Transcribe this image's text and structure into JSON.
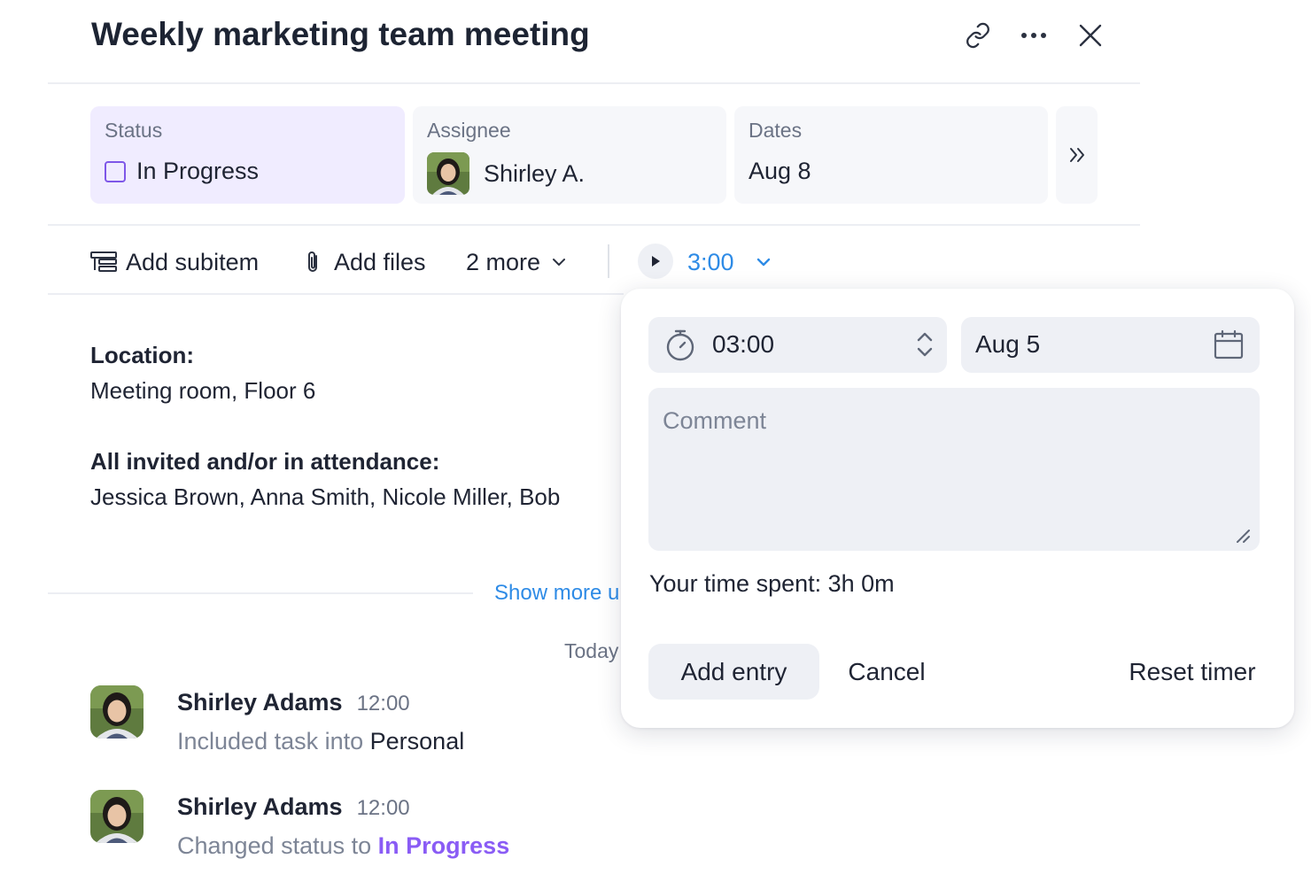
{
  "header": {
    "title": "Weekly marketing team meeting"
  },
  "fields": {
    "status": {
      "label": "Status",
      "value": "In Progress"
    },
    "assignee": {
      "label": "Assignee",
      "value": "Shirley A."
    },
    "dates": {
      "label": "Dates",
      "value": "Aug 8"
    }
  },
  "toolbar": {
    "add_subitem": "Add subitem",
    "add_files": "Add files",
    "more": "2 more",
    "timer": "3:00"
  },
  "description": {
    "location_label": "Location:",
    "location_value": "Meeting room, Floor 6",
    "attendees_label": "All invited and/or in attendance:",
    "attendees_value": "Jessica Brown, Anna Smith, Nicole Miller, Bob"
  },
  "show_more": "Show more u",
  "date_divider": "Today",
  "activity": [
    {
      "name": "Shirley Adams",
      "time": "12:00",
      "prefix": "Included task into ",
      "target": "Personal"
    },
    {
      "name": "Shirley Adams",
      "time": "12:00",
      "prefix": "Changed status to ",
      "target": "In Progress"
    }
  ],
  "time_entry": {
    "duration": "03:00",
    "date": "Aug 5",
    "comment_placeholder": "Comment",
    "time_spent": "Your time spent: 3h 0m",
    "add_entry": "Add entry",
    "cancel": "Cancel",
    "reset_timer": "Reset timer"
  },
  "colors": {
    "status_bg": "#f0ecff",
    "status_border": "#7e57e8",
    "accent_blue": "#2e8be6",
    "accent_purple": "#8a5cf5"
  }
}
